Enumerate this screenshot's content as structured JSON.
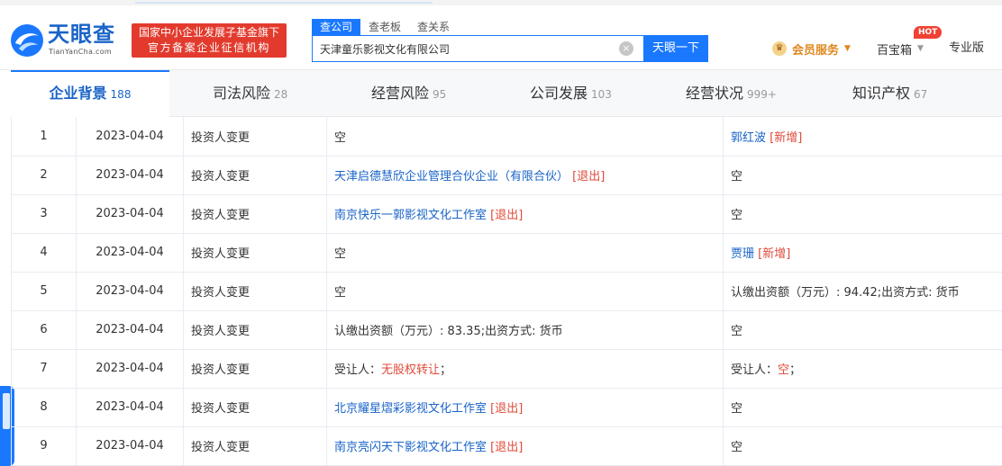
{
  "header": {
    "logo_cn": "天眼查",
    "logo_en": "TianYanCha.com",
    "badge_line1": "国家中小企业发展子基金旗下",
    "badge_line2": "官方备案企业征信机构",
    "search_tabs": [
      {
        "label": "查公司"
      },
      {
        "label": "查老板"
      },
      {
        "label": "查关系"
      }
    ],
    "search_value": "天津童乐影视文化有限公司",
    "search_button": "天眼一下",
    "vip_label": "会员服务",
    "treasure_label": "百宝箱",
    "hot_badge": "HOT",
    "pro_label": "专业版"
  },
  "nav": {
    "items": [
      {
        "label": "企业背景",
        "count": "188"
      },
      {
        "label": "司法风险",
        "count": "28"
      },
      {
        "label": "经营风险",
        "count": "95"
      },
      {
        "label": "公司发展",
        "count": "103"
      },
      {
        "label": "经营状况",
        "count": "999+"
      },
      {
        "label": "知识产权",
        "count": "67"
      }
    ]
  },
  "table": {
    "rows": [
      {
        "idx": "1",
        "date": "2023-04-04",
        "type": "投资人变更",
        "before": "空",
        "after_link": "郭红波",
        "after_tag": "[新增]"
      },
      {
        "idx": "2",
        "date": "2023-04-04",
        "type": "投资人变更",
        "before_link": "天津启德慧欣企业管理合伙企业（有限合伙）",
        "before_tag": "[退出]",
        "after": "空"
      },
      {
        "idx": "3",
        "date": "2023-04-04",
        "type": "投资人变更",
        "before_link": "南京快乐一郭影视文化工作室",
        "before_tag": "[退出]",
        "after": "空"
      },
      {
        "idx": "4",
        "date": "2023-04-04",
        "type": "投资人变更",
        "before": "空",
        "after_link": "贾珊",
        "after_tag": "[新增]"
      },
      {
        "idx": "5",
        "date": "2023-04-04",
        "type": "投资人变更",
        "before": "空",
        "after": "认缴出资额（万元）: 94.42;出资方式: 货币"
      },
      {
        "idx": "6",
        "date": "2023-04-04",
        "type": "投资人变更",
        "before": "认缴出资额（万元）: 83.35;出资方式: 货币",
        "after": "空"
      },
      {
        "idx": "7",
        "date": "2023-04-04",
        "type": "投资人变更",
        "before_prefix": "受让人：",
        "before_red": "无股权转让",
        "before_suffix": "；",
        "after_prefix": "受让人：",
        "after_red": "空",
        "after_suffix": "；"
      },
      {
        "idx": "8",
        "date": "2023-04-04",
        "type": "投资人变更",
        "before_link": "北京耀星熠彩影视文化工作室",
        "before_tag": "[退出]",
        "after": "空"
      },
      {
        "idx": "9",
        "date": "2023-04-04",
        "type": "投资人变更",
        "before_link": "南京亮闪天下影视文化工作室",
        "before_tag": "[退出]",
        "after": "空"
      }
    ]
  },
  "colors": {
    "brand_blue": "#1a78ff",
    "link_blue": "#1a64c8",
    "badge_red": "#e23b2e",
    "tag_red": "#e04a3a",
    "vip_orange": "#e0881e"
  }
}
